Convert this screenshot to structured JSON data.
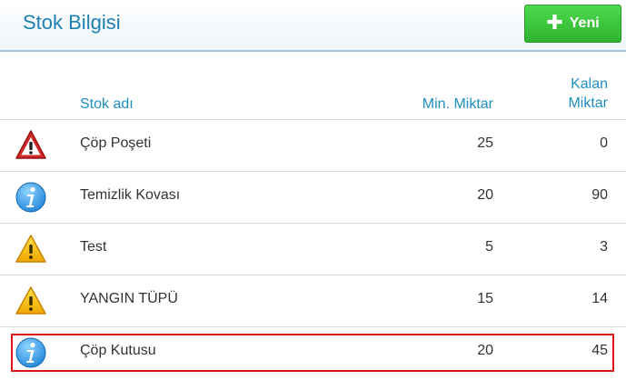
{
  "header": {
    "title": "Stok Bilgisi",
    "new_button_label": "Yeni"
  },
  "columns": {
    "name": "Stok adı",
    "min": "Min. Miktar",
    "remaining_line1": "Kalan",
    "remaining_line2": "Miktar"
  },
  "rows": [
    {
      "icon": "danger-icon",
      "name": "Çöp Poşeti",
      "min": "25",
      "remaining": "0"
    },
    {
      "icon": "info-icon",
      "name": "Temizlik Kovası",
      "min": "20",
      "remaining": "90"
    },
    {
      "icon": "warning-icon",
      "name": "Test",
      "min": "5",
      "remaining": "3"
    },
    {
      "icon": "warning-icon",
      "name": "YANGIN TÜPÜ",
      "min": "15",
      "remaining": "14"
    },
    {
      "icon": "info-icon",
      "name": "Çöp Kutusu",
      "min": "20",
      "remaining": "45"
    }
  ],
  "colors": {
    "title": "#1e7fb1",
    "header_text": "#1e8fc0",
    "button": "#2eb32e",
    "highlight": "#e0151a"
  }
}
